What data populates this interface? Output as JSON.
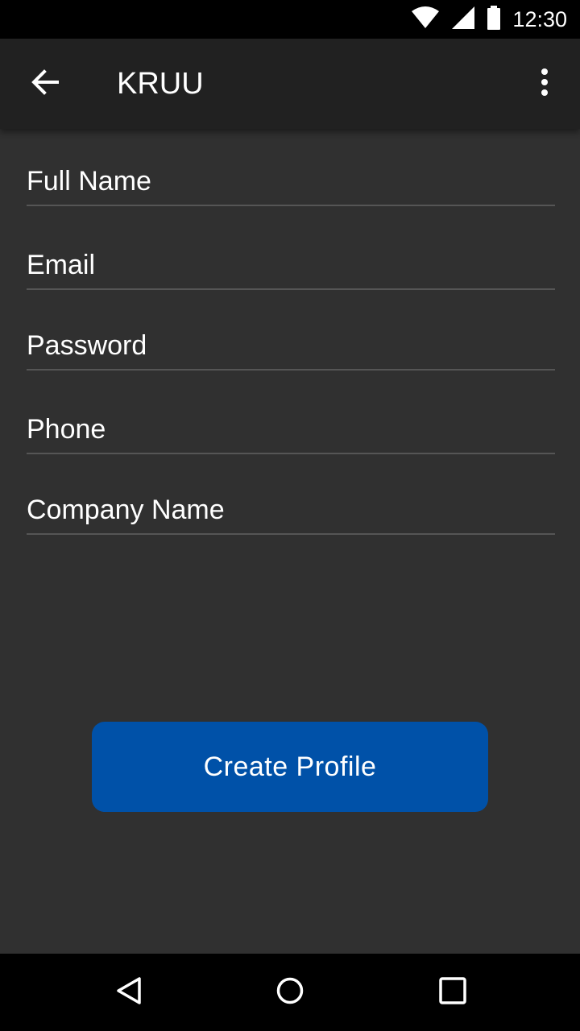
{
  "status_bar": {
    "time": "12:30",
    "icons": [
      "wifi-icon",
      "cellular-signal-icon",
      "battery-icon"
    ]
  },
  "app_bar": {
    "title": "KRUU",
    "back_icon": "arrow-back-icon",
    "menu_icon": "more-vert-icon"
  },
  "form": {
    "full_name": {
      "placeholder": "Full Name",
      "value": ""
    },
    "email": {
      "placeholder": "Email",
      "value": ""
    },
    "password": {
      "placeholder": "Password",
      "value": ""
    },
    "phone": {
      "placeholder": "Phone",
      "value": ""
    },
    "company_name": {
      "placeholder": "Company Name",
      "value": ""
    }
  },
  "create_button": {
    "label": "Create Profile"
  },
  "nav_bar": {
    "icons": [
      "back-triangle-icon",
      "home-circle-icon",
      "recents-square-icon"
    ]
  },
  "colors": {
    "background": "#303030",
    "app_bar": "#212121",
    "accent_button": "#0051a8",
    "divider": "#555555"
  }
}
